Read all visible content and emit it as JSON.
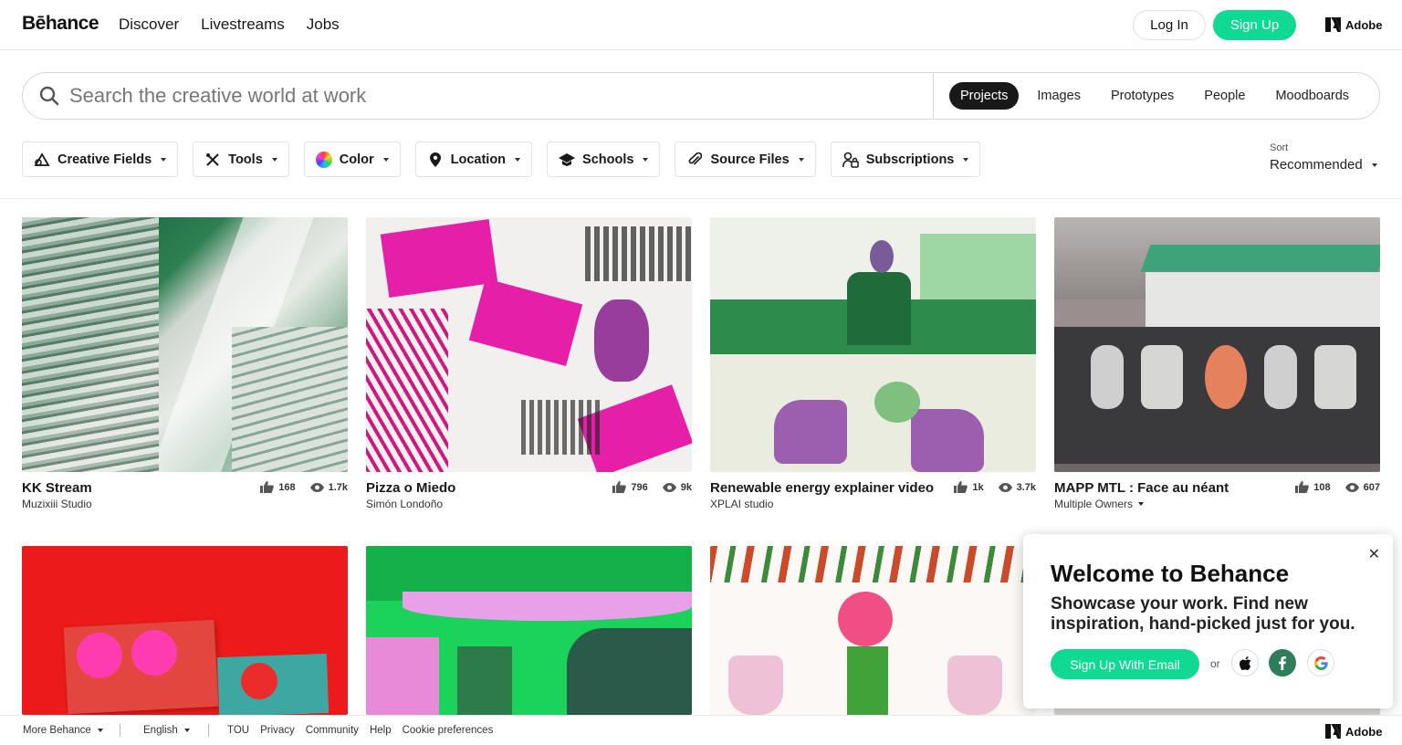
{
  "header": {
    "logo": "Bēhance",
    "nav": [
      "Discover",
      "Livestreams",
      "Jobs"
    ],
    "login_label": "Log In",
    "signup_label": "Sign Up",
    "adobe_label": "Adobe"
  },
  "search": {
    "placeholder": "Search the creative world at work",
    "types": [
      "Projects",
      "Images",
      "Prototypes",
      "People",
      "Moodboards"
    ],
    "active_type": "Projects"
  },
  "filters": [
    "Creative Fields",
    "Tools",
    "Color",
    "Location",
    "Schools",
    "Source Files",
    "Subscriptions"
  ],
  "sort": {
    "label": "Sort",
    "value": "Recommended"
  },
  "projects": [
    {
      "title": "KK Stream",
      "owner": "Muzixiii Studio",
      "likes": "168",
      "views": "1.7k"
    },
    {
      "title": "Pizza o Miedo",
      "owner": "Simón Londoño",
      "likes": "796",
      "views": "9k"
    },
    {
      "title": "Renewable energy explainer video",
      "owner": "XPLAI studio",
      "likes": "1k",
      "views": "3.7k"
    },
    {
      "title": "MAPP MTL : Face au néant",
      "owner": "Multiple Owners",
      "likes": "108",
      "views": "607"
    }
  ],
  "popup": {
    "close": "✕",
    "title": "Welcome to Behance",
    "text": "Showcase your work. Find new inspiration, hand-picked just for you.",
    "email_button": "Sign Up With Email",
    "or": "or"
  },
  "footer": {
    "more": "More Behance",
    "language": "English",
    "links": [
      "TOU",
      "Privacy",
      "Community",
      "Help",
      "Cookie preferences"
    ],
    "adobe_label": "Adobe"
  },
  "colors": {
    "brand_green": "#0fd993",
    "dark": "#191919"
  }
}
